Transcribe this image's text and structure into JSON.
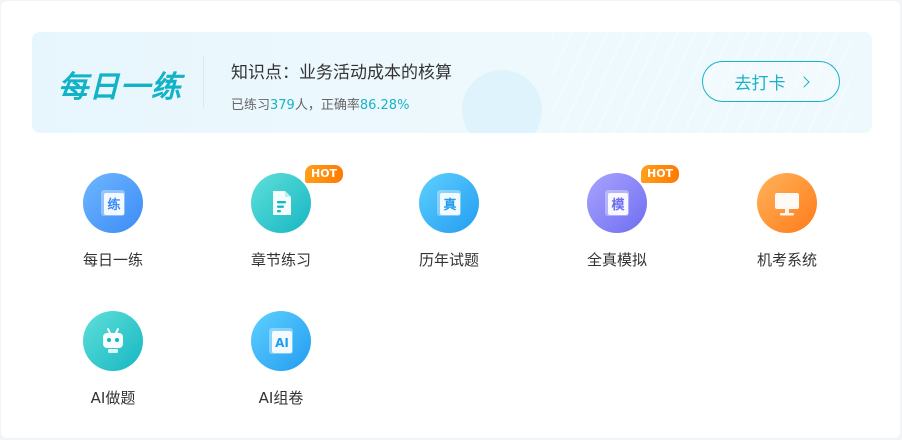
{
  "banner": {
    "brand": "每日一练",
    "knowledge_point": "知识点：业务活动成本的核算",
    "stat_prefix": "已练习",
    "practiced_count": "379",
    "stat_middle": "人，正确率",
    "accuracy": "86.28%",
    "cta_label": "去打卡"
  },
  "items": [
    {
      "label": "每日一练",
      "icon": "daily-practice-icon",
      "glyph": "练",
      "hot": ""
    },
    {
      "label": "章节练习",
      "icon": "document-icon",
      "glyph": "",
      "hot": "HOT"
    },
    {
      "label": "历年试题",
      "icon": "past-exam-icon",
      "glyph": "真",
      "hot": ""
    },
    {
      "label": "全真模拟",
      "icon": "mock-exam-icon",
      "glyph": "模",
      "hot": "HOT"
    },
    {
      "label": "机考系统",
      "icon": "computer-icon",
      "glyph": "",
      "hot": ""
    },
    {
      "label": "AI做题",
      "icon": "robot-icon",
      "glyph": "",
      "hot": ""
    },
    {
      "label": "AI组卷",
      "icon": "ai-paper-icon",
      "glyph": "AI",
      "hot": ""
    }
  ],
  "colors": {
    "accent": "#18b3c4",
    "hot": "#ff8a00"
  }
}
